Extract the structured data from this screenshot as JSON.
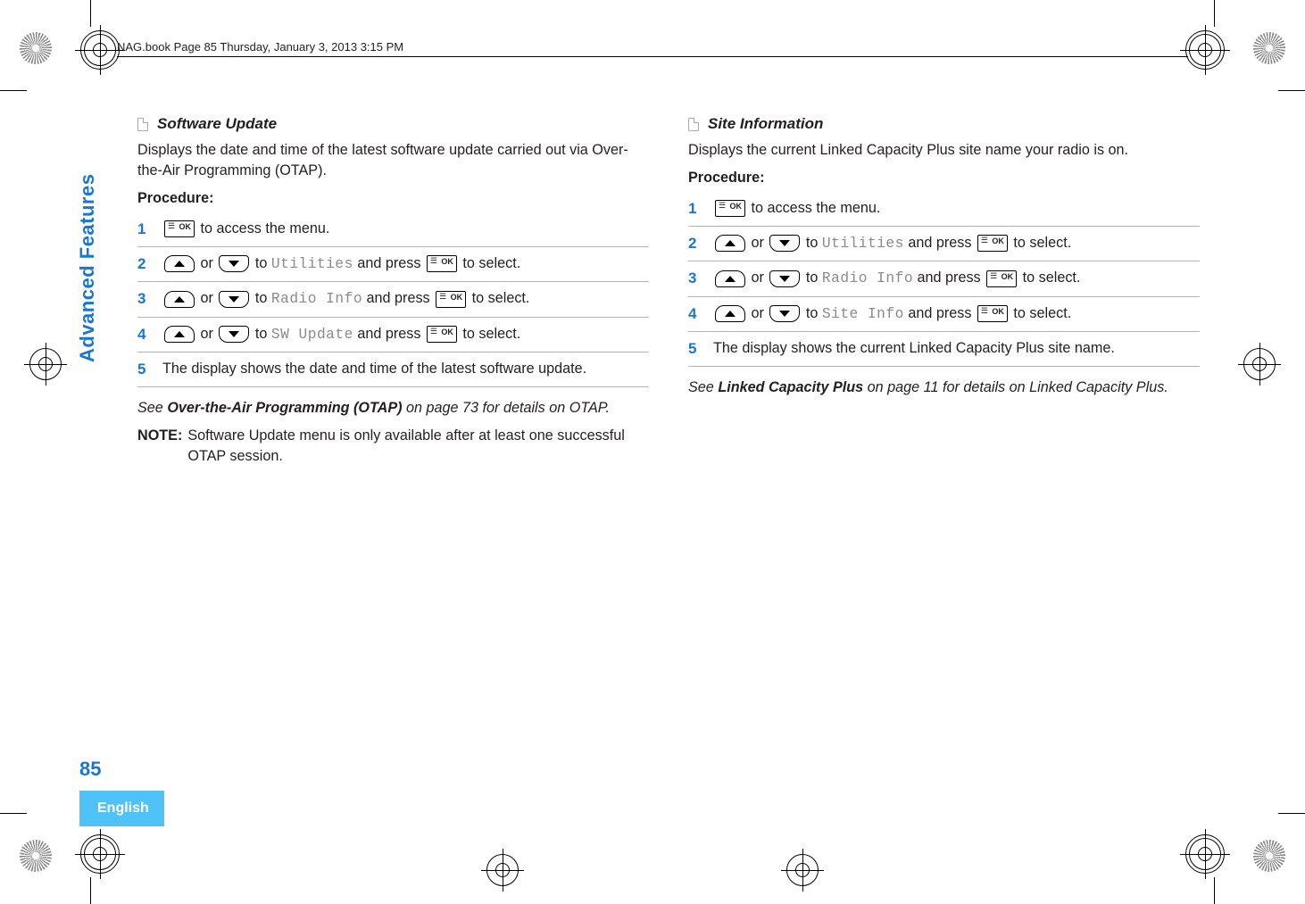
{
  "header": "NAG.book  Page 85  Thursday, January 3, 2013  3:15 PM",
  "side": {
    "vertical": "Advanced Features",
    "language": "English",
    "page_number": "85"
  },
  "left": {
    "title": "Software Update",
    "intro": "Displays the date and time of the latest software update carried out via Over-the-Air Programming (OTAP).",
    "procedure_label": "Procedure:",
    "steps": {
      "s1_tail": " to access the menu.",
      "s2_pre": " or ",
      "s2_mid": " to ",
      "s2_menu": "Utilities",
      "s2_post": " and press ",
      "s2_end": " to select.",
      "s3_menu": "Radio Info",
      "s4_menu": "SW Update",
      "s5": "The display shows the date and time of the latest software update."
    },
    "ref_pre": "See ",
    "ref_bold": "Over-the-Air Programming (OTAP)",
    "ref_post": " on page 73 for details on OTAP.",
    "note_label": "NOTE:",
    "note_text": "Software Update menu is only available after at least one successful OTAP session."
  },
  "right": {
    "title": "Site Information",
    "intro": "Displays the current Linked Capacity Plus site name your radio is on.",
    "procedure_label": "Procedure:",
    "steps": {
      "s1_tail": " to access the menu.",
      "s2_menu": "Utilities",
      "s3_menu": "Radio Info",
      "s4_menu": "Site Info",
      "s5": "The display shows the current Linked Capacity Plus site name."
    },
    "ref_pre": "See ",
    "ref_bold": "Linked Capacity Plus",
    "ref_post": " on page 11 for details on Linked Capacity Plus.",
    "common": {
      "or": " or ",
      "to": " to ",
      "andpress": " and press ",
      "toselect": " to select."
    }
  },
  "nums": {
    "1": "1",
    "2": "2",
    "3": "3",
    "4": "4",
    "5": "5"
  }
}
